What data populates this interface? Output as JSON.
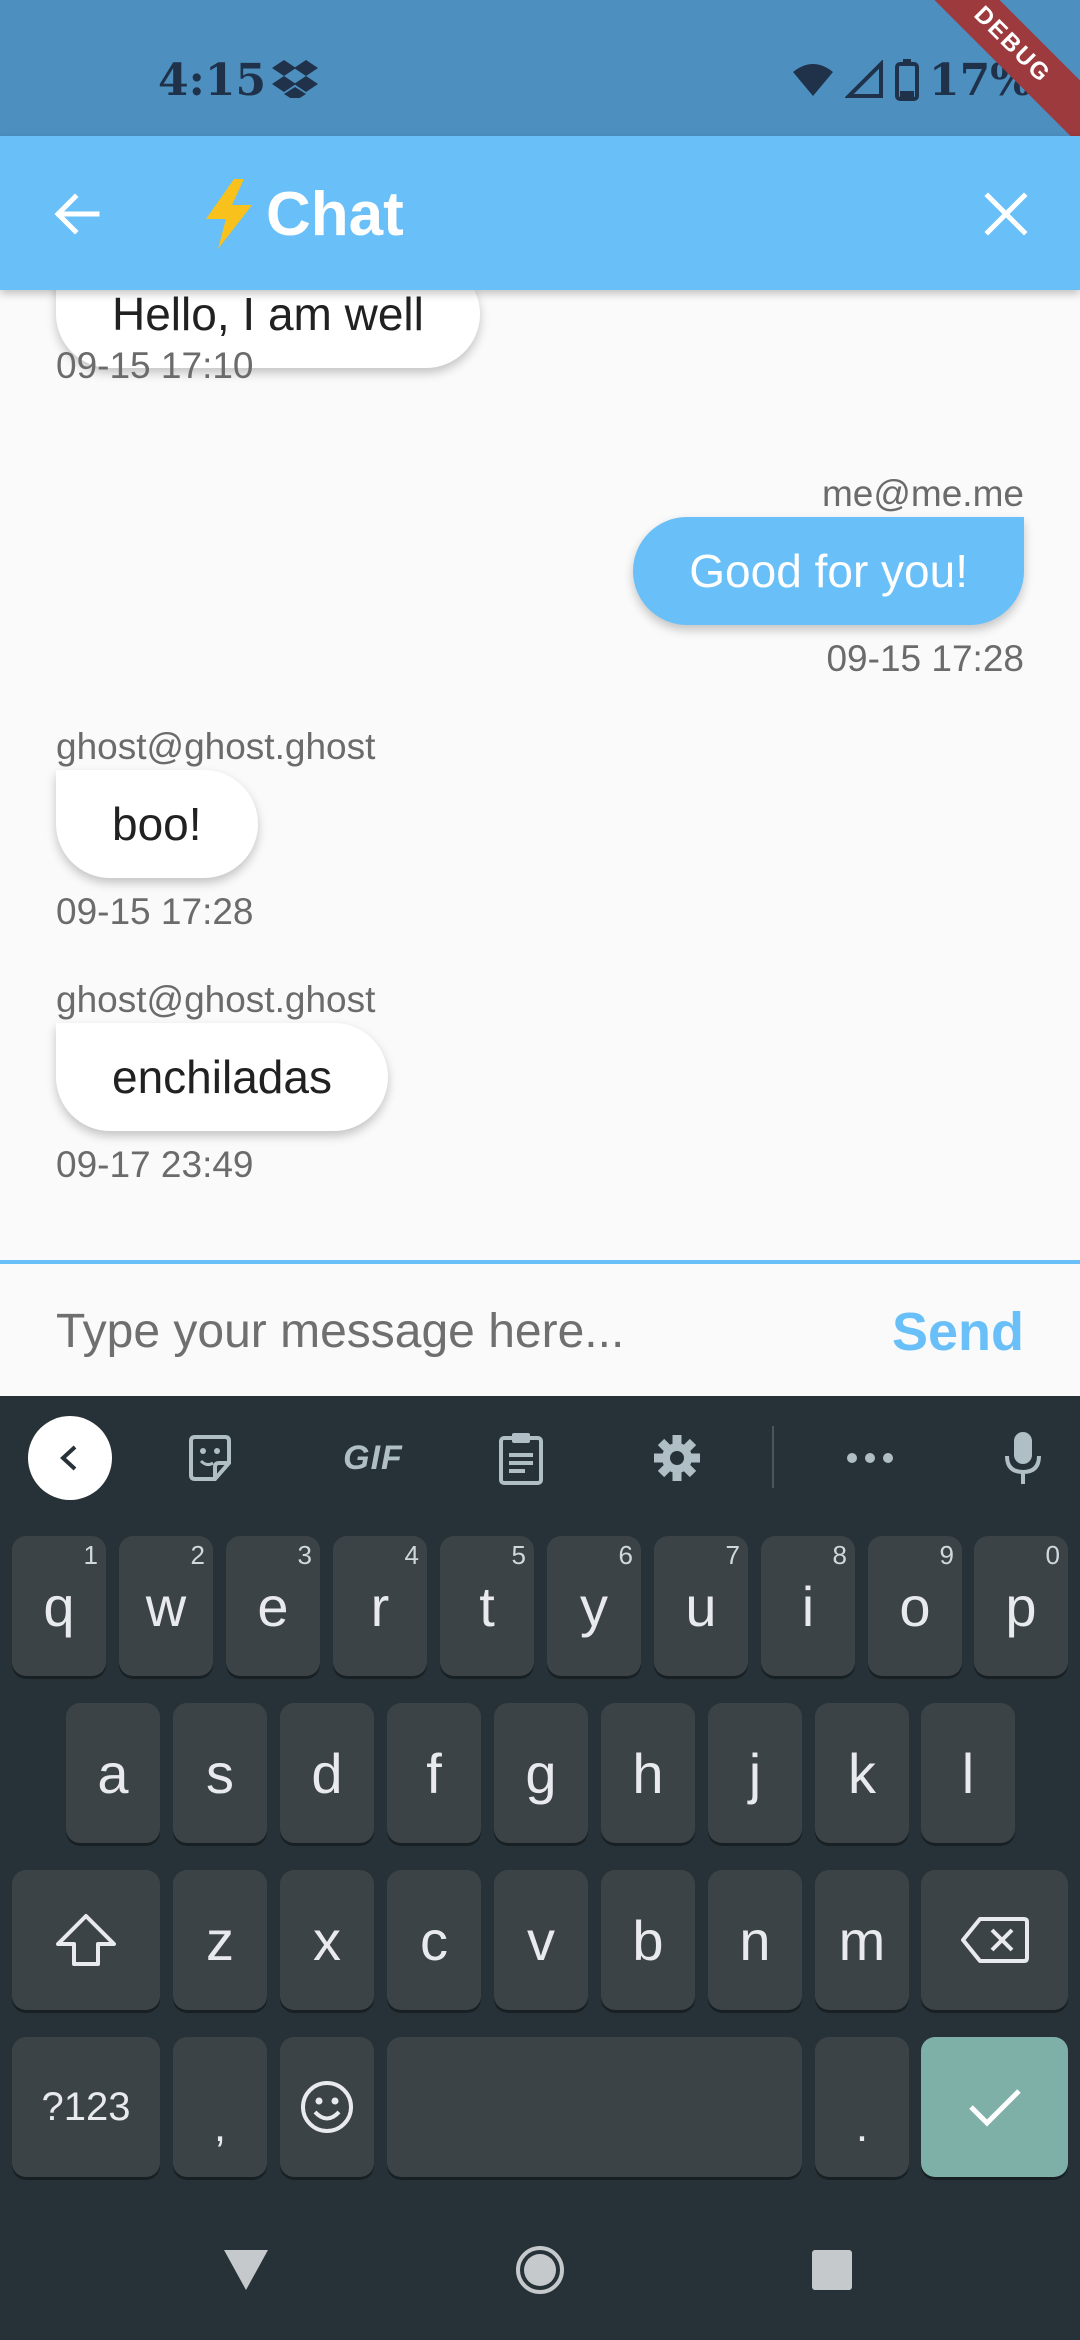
{
  "status_bar": {
    "time": "4:15",
    "battery_percent": "17%",
    "debug_label": "DEBUG",
    "icons": [
      "dropbox-icon",
      "wifi-icon",
      "cell-signal-icon",
      "battery-icon"
    ]
  },
  "app_bar": {
    "title": "Chat",
    "title_icon": "lightning-icon",
    "back_icon": "arrow-back-icon",
    "close_icon": "close-icon",
    "color": "#69bff7"
  },
  "messages": [
    {
      "sender": "",
      "text": "Hello, I am well",
      "time": "09-15 17:10",
      "outgoing": false
    },
    {
      "sender": "me@me.me",
      "text": "Good for you!",
      "time": "09-15 17:28",
      "outgoing": true
    },
    {
      "sender": "ghost@ghost.ghost",
      "text": "boo!",
      "time": "09-15 17:28",
      "outgoing": false
    },
    {
      "sender": "ghost@ghost.ghost",
      "text": "enchiladas",
      "time": "09-17 23:49",
      "outgoing": false
    }
  ],
  "composer": {
    "placeholder": "Type your message here...",
    "value": "",
    "send_label": "Send"
  },
  "keyboard": {
    "toolbar": {
      "gif_label": "GIF"
    },
    "row1": [
      {
        "key": "q",
        "hint": "1"
      },
      {
        "key": "w",
        "hint": "2"
      },
      {
        "key": "e",
        "hint": "3"
      },
      {
        "key": "r",
        "hint": "4"
      },
      {
        "key": "t",
        "hint": "5"
      },
      {
        "key": "y",
        "hint": "6"
      },
      {
        "key": "u",
        "hint": "7"
      },
      {
        "key": "i",
        "hint": "8"
      },
      {
        "key": "o",
        "hint": "9"
      },
      {
        "key": "p",
        "hint": "0"
      }
    ],
    "row2": [
      "a",
      "s",
      "d",
      "f",
      "g",
      "h",
      "j",
      "k",
      "l"
    ],
    "row3": [
      "z",
      "x",
      "c",
      "v",
      "b",
      "n",
      "m"
    ],
    "symbols_label": "?123",
    "comma_label": ",",
    "period_label": ".",
    "enter_color": "#7fb0a8"
  },
  "nav_bar": {
    "icons": [
      "back-triangle-icon",
      "home-circle-icon",
      "recents-square-icon"
    ]
  }
}
